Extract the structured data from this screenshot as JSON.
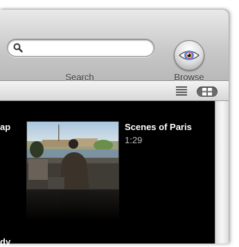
{
  "toolbar": {
    "search_label": "Search",
    "search_placeholder": "",
    "browse_label": "Browse"
  },
  "content": {
    "left_item_title_fragment": "ap",
    "left_item_bottom_fragment": "dy",
    "movie": {
      "title": "Scenes of Paris",
      "duration": "1:29"
    }
  },
  "icons": {
    "search": "magnifier-icon",
    "browse": "eye-icon",
    "list_view": "list-lines-icon",
    "grid_view": "grid-icon"
  },
  "colors": {
    "content_background": "#000000",
    "toolbar_top": "#e9e9e9",
    "toolbar_bottom": "#b9b9b9",
    "title_text": "#ffffff",
    "subtitle_text": "#b8b8b8"
  }
}
